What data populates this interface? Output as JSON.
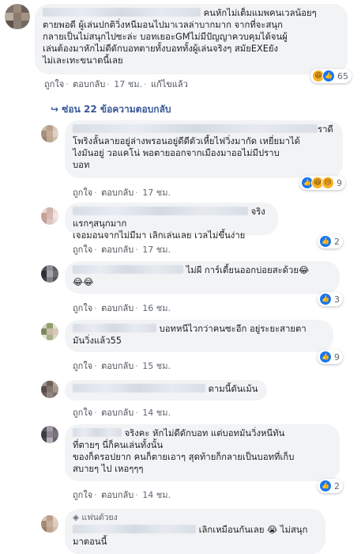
{
  "comments": [
    {
      "lines": [
        "คนหักไม่เต็มแมพคนเวลน้อยๆ",
        "ตายพอดี ผู้เล่นปกติวิ่งหนีมอนไปมาเวลล่าบากมาก จากที่จะสนุก",
        "กลายเป็นไม่สนุกไปซะล่ะ บอทเยอะGMไม่มีปัญญาควบคุมได้จนผู้",
        "เล่นต้องมาหักไม่ดีดักบอทตายทั้งบอททั้งผู้เล่นจริงๆ สมัยEXEยัง",
        "ไม่เละเทะขนาดนี้เลย"
      ],
      "like": "ถูกใจ",
      "reply": "ตอบกลับ",
      "time": "17 ชม.",
      "edited": "แก้ไขแล้ว",
      "reaction_count": "65"
    }
  ],
  "replies_toggle": "ซ่อน 22 ข้อความตอบกลับ",
  "replies": [
    {
      "lines": [
        "ราดี",
        "โพริงลั้นลายอยู่ล่างพรอนอยู่ดีดีตัวเหี้ยไฟวิ่งมากัด เหยี่ยมาได้",
        "ไงมันอยู่ วอแคโน่ พอตายออกจากเมืองมาออไม่มีปราบ",
        "บอท"
      ],
      "like": "ถูกใจ",
      "reply": "ตอบกลับ",
      "time": "17 ชม.",
      "reaction_count": "9"
    },
    {
      "lines": [
        "จริง แรกๆสนุกมาก",
        "เจอมอนจากไม่มีมา เลิกเล่นเลย เวลไม่ขึ้นง่าย"
      ],
      "like": "ถูกใจ",
      "reply": "ตอบกลับ",
      "time": "17 ชม.",
      "reaction_count": "2"
    },
    {
      "lines": [
        "ไม่ผี การ์เดี้ยนออกบ่อยสะด้วย😂",
        "😂😂"
      ],
      "like": "ถูกใจ",
      "reply": "ตอบกลับ",
      "time": "16 ชม.",
      "reaction_count": "3"
    },
    {
      "lines": [
        "บอทหนีไวกว่าคนซะอีก อยู่ระยะสายตา",
        "มันวิ่งแล้ว55"
      ],
      "like": "ถูกใจ",
      "reply": "ตอบกลับ",
      "time": "15 ชม.",
      "reaction_count": "9"
    },
    {
      "lines": [
        "ดามนี้ดันเม้น"
      ],
      "like": "ถูกใจ",
      "reply": "ตอบกลับ",
      "time": "14 ชม."
    },
    {
      "lines": [
        "จริงคะ หักไม่ดีดักบอท แต่บอทมันวิ่งหนีทัน",
        "ที่ตายๆ นี่ก็คนเล่นทั้งนั้น",
        "ของก็ดรอปยาก คนก็ตายเอาๆ สุดท้ายก็กลายเป็นบอทที่เก็บ",
        "สบายๆ ไป เหอๆๆๆ"
      ],
      "like": "ถูกใจ",
      "reply": "ตอบกลับ",
      "time": "14 ชม.",
      "reaction_count": "2"
    },
    {
      "badge": "แฟนตัวยง",
      "lines": [
        "เลิกเหมือนกันเลย 😭 ไม่สนุก",
        "มาตอนนี้"
      ]
    }
  ],
  "colors": {
    "link": "#385898",
    "meta": "#606770",
    "bubble": "#f2f3f5"
  }
}
